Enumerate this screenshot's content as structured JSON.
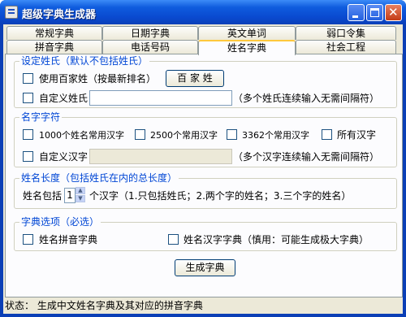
{
  "window": {
    "title": "超级字典生成器"
  },
  "tabs_row1": [
    "常规字典",
    "日期字典",
    "英文单词",
    "弱口令集"
  ],
  "tabs_row2": [
    "拼音字典",
    "电话号码",
    "姓名字典",
    "社会工程"
  ],
  "active_tab": "姓名字典",
  "surname": {
    "legend": "设定姓氏（默认不包括姓氏）",
    "use_baijia_label": "使用百家姓（按最新排名）",
    "baijia_button": "百 家 姓",
    "custom_label": "自定义姓氏",
    "custom_value": "",
    "custom_hint": "（多个姓氏连续输入无需间隔符）"
  },
  "name_chars": {
    "legend": "名字字符",
    "opt1": "1000个姓名常用汉字",
    "opt2": "2500个常用汉字",
    "opt3": "3362个常用汉字",
    "opt4": "所有汉字",
    "custom_label": "自定义汉字",
    "custom_value": "",
    "custom_hint": "（多个汉字连续输入无需间隔符）"
  },
  "name_length": {
    "legend": "姓名长度（包括姓氏在内的总长度）",
    "prefix": "姓名包括",
    "value": "1",
    "suffix": "个汉字（1.只包括姓氏；2.两个字的姓名；3.三个字的姓名）"
  },
  "dict_options": {
    "legend": "字典选项（必选）",
    "pinyin_label": "姓名拼音字典",
    "hanzi_label": "姓名汉字字典（慎用：可能生成极大字典）"
  },
  "generate_button": "生成字典",
  "status": "状态： 生成中文姓名字典及其对应的拼音字典"
}
